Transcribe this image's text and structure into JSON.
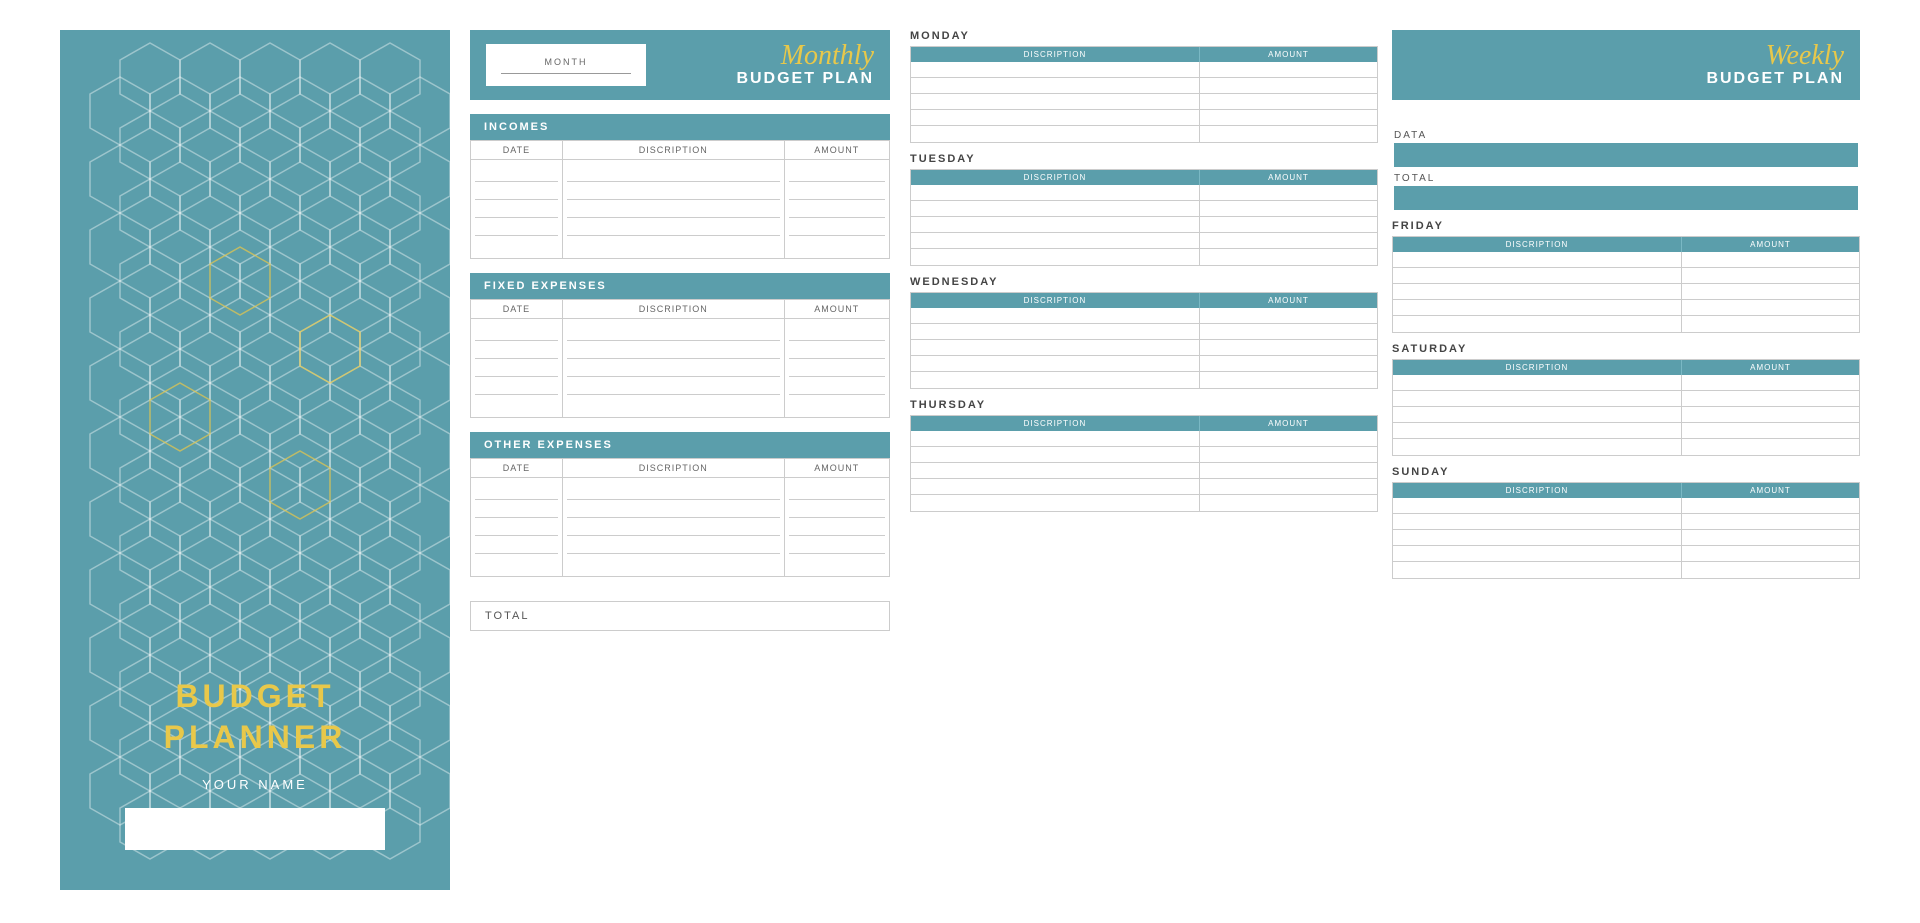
{
  "cover": {
    "title_line1": "BUDGET",
    "title_line2": "PLANNER",
    "subtitle": "YOUR NAME",
    "name_placeholder": ""
  },
  "monthly": {
    "month_label": "MONTH",
    "script_title": "Monthly",
    "bold_title": "BUDGET PLAN",
    "sections": [
      {
        "id": "incomes",
        "header": "INCOMES",
        "col_date": "DATE",
        "col_desc": "DISCRIPTION",
        "col_amount": "AMOUNT",
        "rows": 5
      },
      {
        "id": "fixed_expenses",
        "header": "FIXED EXPENSES",
        "col_date": "DATE",
        "col_desc": "DISCRIPTION",
        "col_amount": "AMOUNT",
        "rows": 5
      },
      {
        "id": "other_expenses",
        "header": "OTHER EXPENSES",
        "col_date": "DATE",
        "col_desc": "DISCRIPTION",
        "col_amount": "AMOUNT",
        "rows": 5
      }
    ],
    "total_label": "TOTAL"
  },
  "weekly": {
    "script_title": "Weekly",
    "bold_title": "BUDGET PLAN",
    "data_label": "DATA",
    "total_label": "TOTAL",
    "days_left": [
      {
        "name": "MONDAY",
        "col_desc": "DISCRIPTION",
        "col_amount": "AMOUNT",
        "rows": 5
      },
      {
        "name": "TUESDAY",
        "col_desc": "DISCRIPTION",
        "col_amount": "AMOUNT",
        "rows": 5
      },
      {
        "name": "WEDNESDAY",
        "col_desc": "DISCRIPTION",
        "col_amount": "AMOUNT",
        "rows": 5
      },
      {
        "name": "THURSDAY",
        "col_desc": "DISCRIPTION",
        "col_amount": "AMOUNT",
        "rows": 5
      }
    ],
    "days_right": [
      {
        "name": "FRIDAY",
        "col_desc": "DISCRIPTION",
        "col_amount": "AMOUNT",
        "rows": 5
      },
      {
        "name": "SATURDAY",
        "col_desc": "DISCRIPTION",
        "col_amount": "AMOUNT",
        "rows": 5
      },
      {
        "name": "SUNDAY",
        "col_desc": "DISCRIPTION",
        "col_amount": "AMOUNT",
        "rows": 5
      }
    ]
  },
  "colors": {
    "teal": "#5b9eab",
    "gold": "#e8c84a",
    "white": "#ffffff",
    "light_border": "#cccccc",
    "text_dark": "#444444",
    "text_mid": "#666666"
  }
}
